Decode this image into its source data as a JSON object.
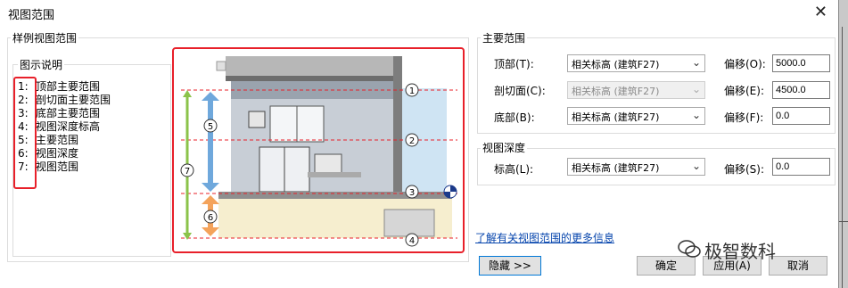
{
  "window": {
    "title": "视图范围",
    "close_glyph": "✕"
  },
  "left_group": {
    "title": "样例视图范围",
    "legend_title": "图示说明",
    "legend_numbers": [
      "1:",
      "2:",
      "3:",
      "4:",
      "5:",
      "6:",
      "7:"
    ],
    "legend_items": [
      "顶部主要范围",
      "剖切面主要范围",
      "底部主要范围",
      "视图深度标高",
      "主要范围",
      "视图深度",
      "视图范围"
    ]
  },
  "diagram": {
    "markers": [
      "1",
      "2",
      "3",
      "4",
      "5",
      "6",
      "7"
    ]
  },
  "primary_range": {
    "title": "主要范围",
    "rows": [
      {
        "label": "顶部(T):",
        "level": "相关标高 (建筑F27)",
        "offset_label": "偏移(O):",
        "offset": "5000.0",
        "disabled": false
      },
      {
        "label": "剖切面(C):",
        "level": "相关标高 (建筑F27)",
        "offset_label": "偏移(E):",
        "offset": "4500.0",
        "disabled": true
      },
      {
        "label": "底部(B):",
        "level": "相关标高 (建筑F27)",
        "offset_label": "偏移(F):",
        "offset": "0.0",
        "disabled": false
      }
    ]
  },
  "view_depth": {
    "title": "视图深度",
    "row": {
      "label": "标高(L):",
      "level": "相关标高 (建筑F27)",
      "offset_label": "偏移(S):",
      "offset": "0.0"
    }
  },
  "link": "了解有关视图范围的更多信息",
  "buttons": {
    "hide": "隐藏 >>",
    "ok": "确定",
    "apply": "应用(A)",
    "cancel": "取消"
  },
  "watermark": "极智数科",
  "colors": {
    "accent_red": "#e8202a",
    "link_blue": "#0645ad",
    "primary_blue": "#0078d7"
  }
}
